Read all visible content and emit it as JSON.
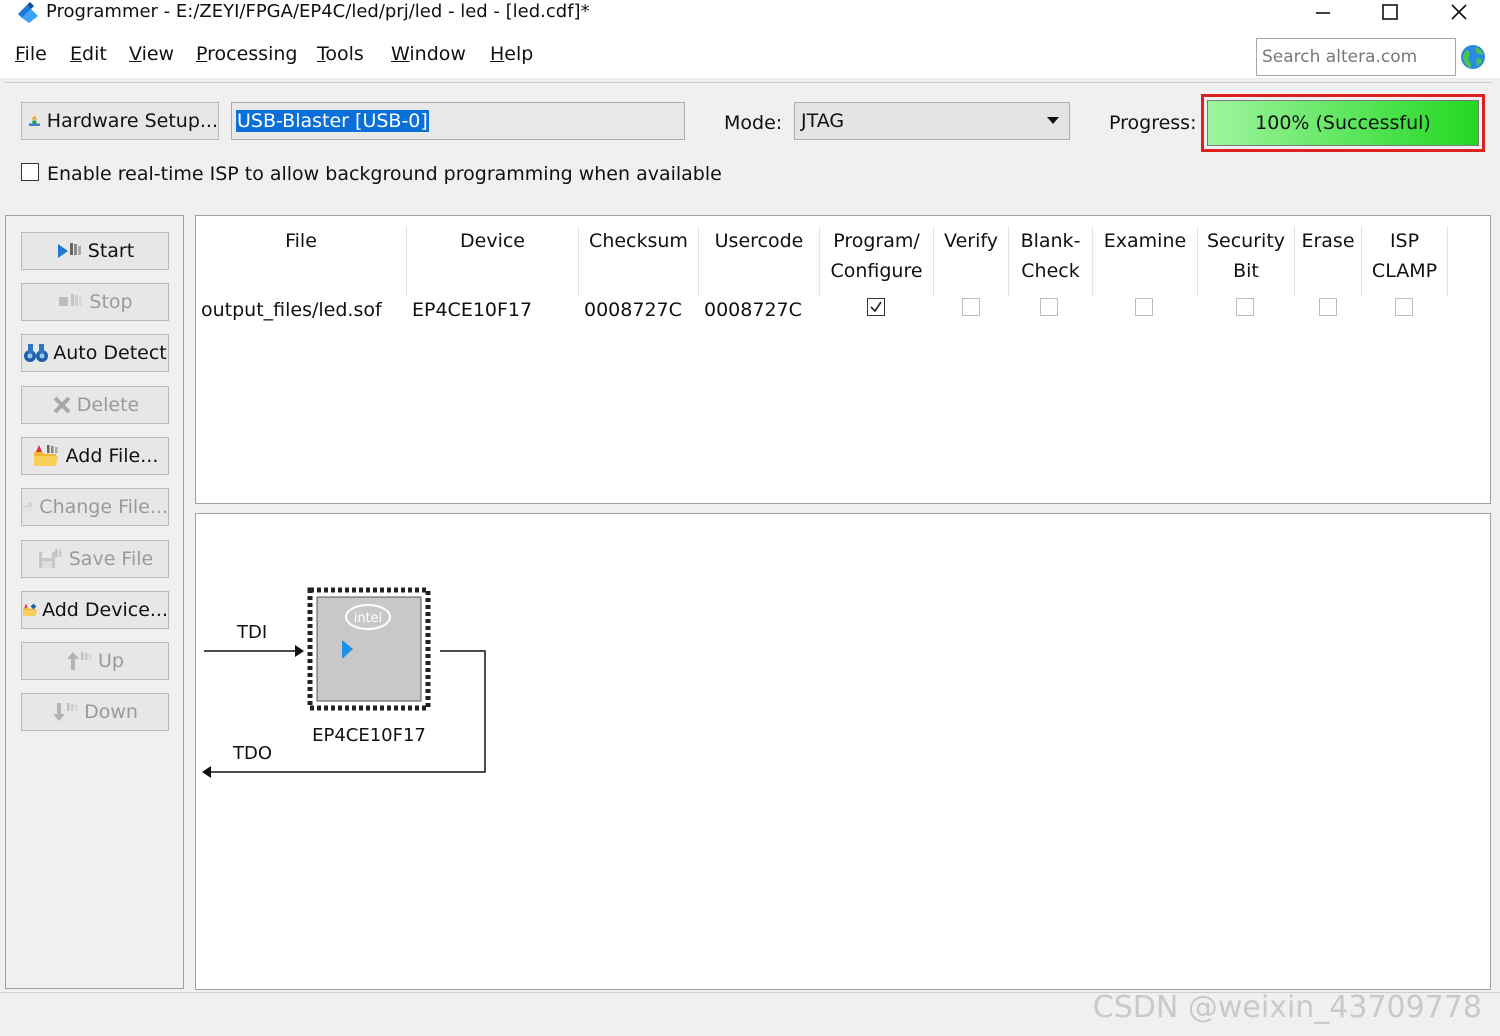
{
  "window": {
    "title": "Programmer - E:/ZEYI/FPGA/EP4C/led/prj/led - led - [led.cdf]*",
    "controls": [
      "minimize",
      "maximize",
      "close"
    ]
  },
  "menu": {
    "items": [
      {
        "mnemonic": "F",
        "rest": "ile"
      },
      {
        "mnemonic": "E",
        "rest": "dit"
      },
      {
        "mnemonic": "V",
        "rest": "iew"
      },
      {
        "mnemonic": "P",
        "rest": "rocessing"
      },
      {
        "mnemonic": "T",
        "rest": "ools"
      },
      {
        "mnemonic": "W",
        "rest": "indow"
      },
      {
        "mnemonic": "H",
        "rest": "elp"
      }
    ],
    "search_placeholder": "Search altera.com"
  },
  "toolbar": {
    "hardware_setup_label": "Hardware Setup...",
    "hardware_value": "USB-Blaster [USB-0]",
    "mode_label": "Mode:",
    "mode_value": "JTAG",
    "progress_label": "Progress:",
    "progress_text": "100% (Successful)",
    "progress_percent": 100,
    "progress_color": "#22d822",
    "highlight_color": "#e02020",
    "isp_label": "Enable real-time ISP to allow background programming when available",
    "isp_checked": false
  },
  "sidebar": {
    "buttons": [
      {
        "label": "Start",
        "enabled": true,
        "icon": "start-icon"
      },
      {
        "label": "Stop",
        "enabled": false,
        "icon": "stop-icon"
      },
      {
        "label": "Auto Detect",
        "enabled": true,
        "icon": "auto-detect-icon"
      },
      {
        "label": "Delete",
        "enabled": false,
        "icon": "delete-icon"
      },
      {
        "label": "Add File...",
        "enabled": true,
        "icon": "add-file-icon"
      },
      {
        "label": "Change File...",
        "enabled": false,
        "icon": "change-file-icon"
      },
      {
        "label": "Save File",
        "enabled": false,
        "icon": "save-file-icon"
      },
      {
        "label": "Add Device...",
        "enabled": true,
        "icon": "add-device-icon"
      },
      {
        "label": "Up",
        "enabled": false,
        "icon": "up-icon"
      },
      {
        "label": "Down",
        "enabled": false,
        "icon": "down-icon"
      }
    ]
  },
  "table": {
    "columns": [
      {
        "line1": "File",
        "line2": ""
      },
      {
        "line1": "Device",
        "line2": ""
      },
      {
        "line1": "Checksum",
        "line2": ""
      },
      {
        "line1": "Usercode",
        "line2": ""
      },
      {
        "line1": "Program/",
        "line2": "Configure"
      },
      {
        "line1": "Verify",
        "line2": ""
      },
      {
        "line1": "Blank-",
        "line2": "Check"
      },
      {
        "line1": "Examine",
        "line2": ""
      },
      {
        "line1": "Security",
        "line2": "Bit"
      },
      {
        "line1": "Erase",
        "line2": ""
      },
      {
        "line1": "ISP",
        "line2": "CLAMP"
      }
    ],
    "rows": [
      {
        "file": "output_files/led.sof",
        "device": "EP4CE10F17",
        "checksum": "0008727C",
        "usercode": "0008727C",
        "program_configure": true,
        "verify": false,
        "blank_check": false,
        "examine": false,
        "security_bit": false,
        "erase": false,
        "isp_clamp": false
      }
    ]
  },
  "chain": {
    "tdi_label": "TDI",
    "tdo_label": "TDO",
    "device_label": "EP4CE10F17",
    "chip_logo": "intel"
  },
  "watermark": "CSDN @weixin_43709778"
}
